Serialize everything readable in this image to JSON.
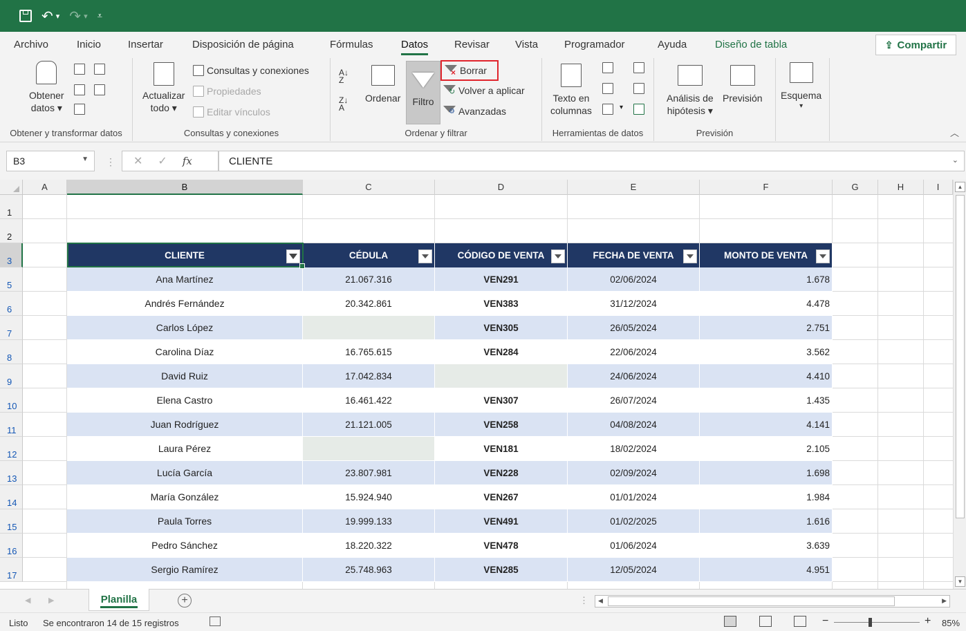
{
  "quick_access": {
    "save_icon": "save-icon",
    "undo_icon": "undo-icon",
    "redo_icon": "redo-icon",
    "customize_icon": "customize-qat-icon"
  },
  "tabs": [
    "Archivo",
    "Inicio",
    "Insertar",
    "Disposición de página",
    "Fórmulas",
    "Datos",
    "Revisar",
    "Vista",
    "Programador",
    "Ayuda",
    "Diseño de tabla"
  ],
  "active_tab": "Datos",
  "share_label": "Compartir",
  "ribbon": {
    "get_data": {
      "line1": "Obtener",
      "line2": "datos"
    },
    "refresh_all": {
      "line1": "Actualizar",
      "line2": "todo"
    },
    "queries_connections": "Consultas y conexiones",
    "properties": "Propiedades",
    "edit_links": "Editar vínculos",
    "sort": "Ordenar",
    "filter": "Filtro",
    "clear": "Borrar",
    "reapply": "Volver a aplicar",
    "advanced": "Avanzadas",
    "text_to_columns": {
      "line1": "Texto en",
      "line2": "columnas"
    },
    "what_if": {
      "line1": "Análisis de",
      "line2": "hipótesis"
    },
    "forecast": "Previsión",
    "outline": "Esquema",
    "groups": {
      "get_transform": "Obtener y transformar datos",
      "queries": "Consultas y conexiones",
      "sort_filter": "Ordenar y filtrar",
      "data_tools": "Herramientas de datos",
      "forecast": "Previsión"
    }
  },
  "formula_bar": {
    "name_box": "B3",
    "fx": "fx",
    "content": "CLIENTE"
  },
  "columns": [
    "A",
    "B",
    "C",
    "D",
    "E",
    "F",
    "G",
    "H",
    "I"
  ],
  "row_numbers": [
    "1",
    "2",
    "3",
    "5",
    "6",
    "7",
    "8",
    "9",
    "10",
    "11",
    "12",
    "13",
    "14",
    "15",
    "16",
    "17"
  ],
  "table": {
    "headers": [
      "CLIENTE",
      "CÉDULA",
      "CÓDIGO DE VENTA",
      "FECHA DE VENTA",
      "MONTO DE VENTA"
    ],
    "rows": [
      [
        "Ana Martínez",
        "21.067.316",
        "VEN291",
        "02/06/2024",
        "1.678"
      ],
      [
        "Andrés Fernández",
        "20.342.861",
        "VEN383",
        "31/12/2024",
        "4.478"
      ],
      [
        "Carlos López",
        "",
        "VEN305",
        "26/05/2024",
        "2.751"
      ],
      [
        "Carolina Díaz",
        "16.765.615",
        "VEN284",
        "22/06/2024",
        "3.562"
      ],
      [
        "David Ruiz",
        "17.042.834",
        "",
        "24/06/2024",
        "4.410"
      ],
      [
        "Elena Castro",
        "16.461.422",
        "VEN307",
        "26/07/2024",
        "1.435"
      ],
      [
        "Juan Rodríguez",
        "21.121.005",
        "VEN258",
        "04/08/2024",
        "4.141"
      ],
      [
        "Laura Pérez",
        "",
        "VEN181",
        "18/02/2024",
        "2.105"
      ],
      [
        "Lucía García",
        "23.807.981",
        "VEN228",
        "02/09/2024",
        "1.698"
      ],
      [
        "María González",
        "15.924.940",
        "VEN267",
        "01/01/2024",
        "1.984"
      ],
      [
        "Paula Torres",
        "19.999.133",
        "VEN491",
        "01/02/2025",
        "1.616"
      ],
      [
        "Pedro Sánchez",
        "18.220.322",
        "VEN478",
        "01/06/2024",
        "3.639"
      ],
      [
        "Sergio Ramírez",
        "25.748.963",
        "VEN285",
        "12/05/2024",
        "4.951"
      ]
    ]
  },
  "sheet_tab": "Planilla",
  "status": {
    "ready": "Listo",
    "message": "Se encontraron 14 de 15 registros",
    "zoom": "85%",
    "minus": "−",
    "plus": "+"
  },
  "colors": {
    "excel_green": "#217346",
    "table_header": "#203764",
    "band_row": "#dae3f3",
    "highlight_red": "#e0242c"
  }
}
